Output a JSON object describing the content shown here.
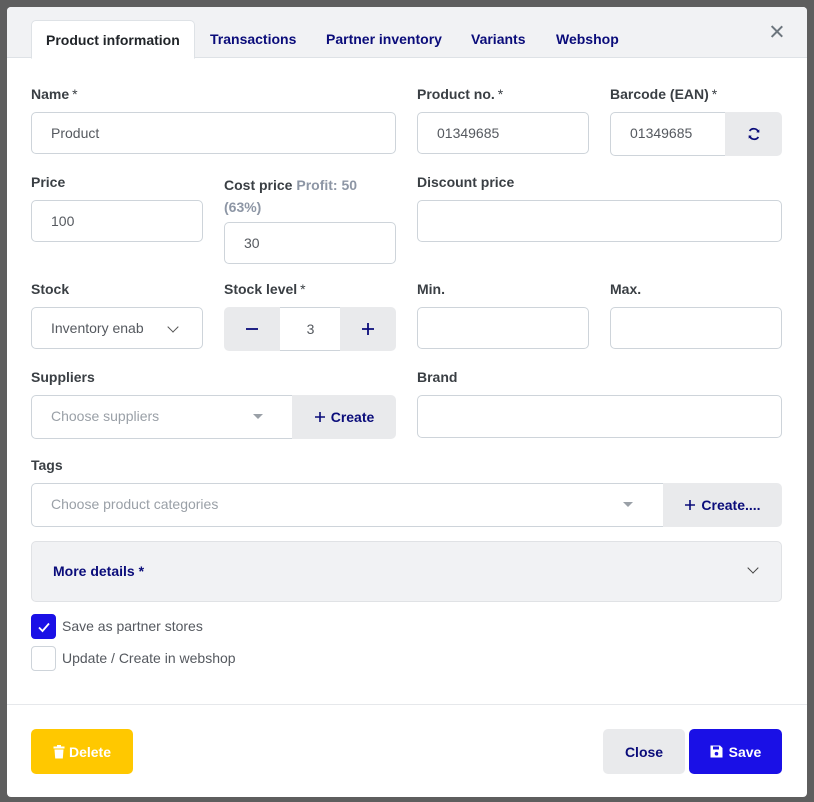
{
  "tabs": [
    "Product information",
    "Transactions",
    "Partner inventory",
    "Variants",
    "Webshop"
  ],
  "name": {
    "label": "Name",
    "req": "*",
    "value": "Product"
  },
  "product_no": {
    "label": "Product no.",
    "req": "*",
    "value": "01349685"
  },
  "barcode": {
    "label": "Barcode (EAN)",
    "req": "*",
    "value": "01349685"
  },
  "price": {
    "label": "Price",
    "value": "100"
  },
  "cost_price": {
    "label": "Cost price",
    "profit_line1": "Profit: 50",
    "profit_line2": "(63%)",
    "value": "30"
  },
  "discount_price": {
    "label": "Discount price",
    "value": ""
  },
  "stock": {
    "label": "Stock",
    "value": "Inventory enab"
  },
  "stock_level": {
    "label": "Stock level",
    "req": "*",
    "value": "3"
  },
  "min": {
    "label": "Min.",
    "value": ""
  },
  "max": {
    "label": "Max.",
    "value": ""
  },
  "suppliers": {
    "label": "Suppliers",
    "placeholder": "Choose suppliers",
    "create": "Create"
  },
  "brand": {
    "label": "Brand",
    "value": ""
  },
  "tags": {
    "label": "Tags",
    "placeholder": "Choose product categories",
    "create": "Create...."
  },
  "more_details": "More details *",
  "save_partner": "Save as partner stores",
  "update_webshop": "Update / Create in webshop",
  "buttons": {
    "delete": "Delete",
    "close": "Close",
    "save": "Save"
  },
  "colors": {
    "primary": "#1a10e6",
    "warning": "#ffc800",
    "navy": "#0a0c7a"
  }
}
